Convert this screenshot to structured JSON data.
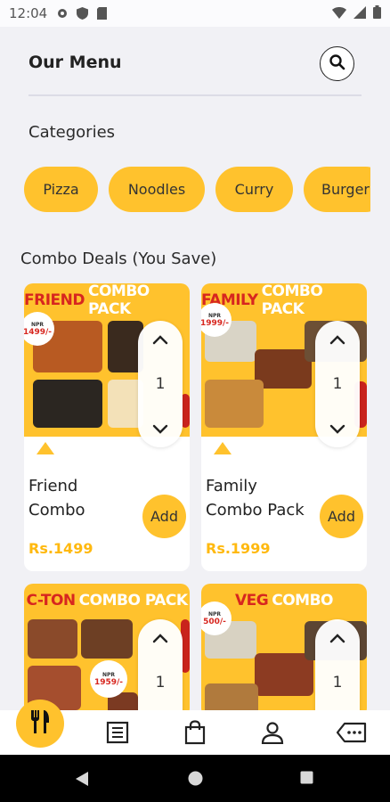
{
  "status_bar": {
    "time": "12:04",
    "icons": [
      "gear-icon",
      "shield-icon",
      "sim-icon",
      "wifi-icon",
      "signal-icon",
      "battery-icon"
    ]
  },
  "header": {
    "title": "Our Menu",
    "search_icon": "search-icon"
  },
  "categories": {
    "label": "Categories",
    "items": [
      "Pizza",
      "Noodles",
      "Curry",
      "Burger"
    ]
  },
  "combo": {
    "label": "Combo Deals (You Save)",
    "cards": [
      {
        "banner_red": "FRIEND",
        "banner_white": "COMBO PACK",
        "tag_npr": "NPR",
        "tag_price": "1499/-",
        "qty": "1",
        "name_line1": "Friend",
        "name_line2": "Combo",
        "add_label": "Add",
        "price": "Rs.1499"
      },
      {
        "banner_red": "FAMILY",
        "banner_white": "COMBO PACK",
        "tag_npr": "NPR",
        "tag_price": "1999/-",
        "qty": "1",
        "name_line1": "Family",
        "name_line2": "Combo Pack",
        "add_label": "Add",
        "price": "Rs.1999"
      },
      {
        "banner_red": "C-TON",
        "banner_white": "COMBO PACK",
        "tag_npr": "NPR",
        "tag_price": "1959/-",
        "qty": "1"
      },
      {
        "banner_red": "VEG",
        "banner_white": "COMBO",
        "tag_npr": "NPR",
        "tag_price": "500/-",
        "qty": "1"
      }
    ]
  },
  "bottom_nav": {
    "items": [
      "restaurant-icon",
      "menu-list-icon",
      "shopping-bag-icon",
      "profile-icon",
      "more-tag-icon"
    ]
  },
  "colors": {
    "accent": "#ffc22d",
    "price": "#ffb90f",
    "banner_red": "#d7261f",
    "background": "#f1f1f5"
  }
}
